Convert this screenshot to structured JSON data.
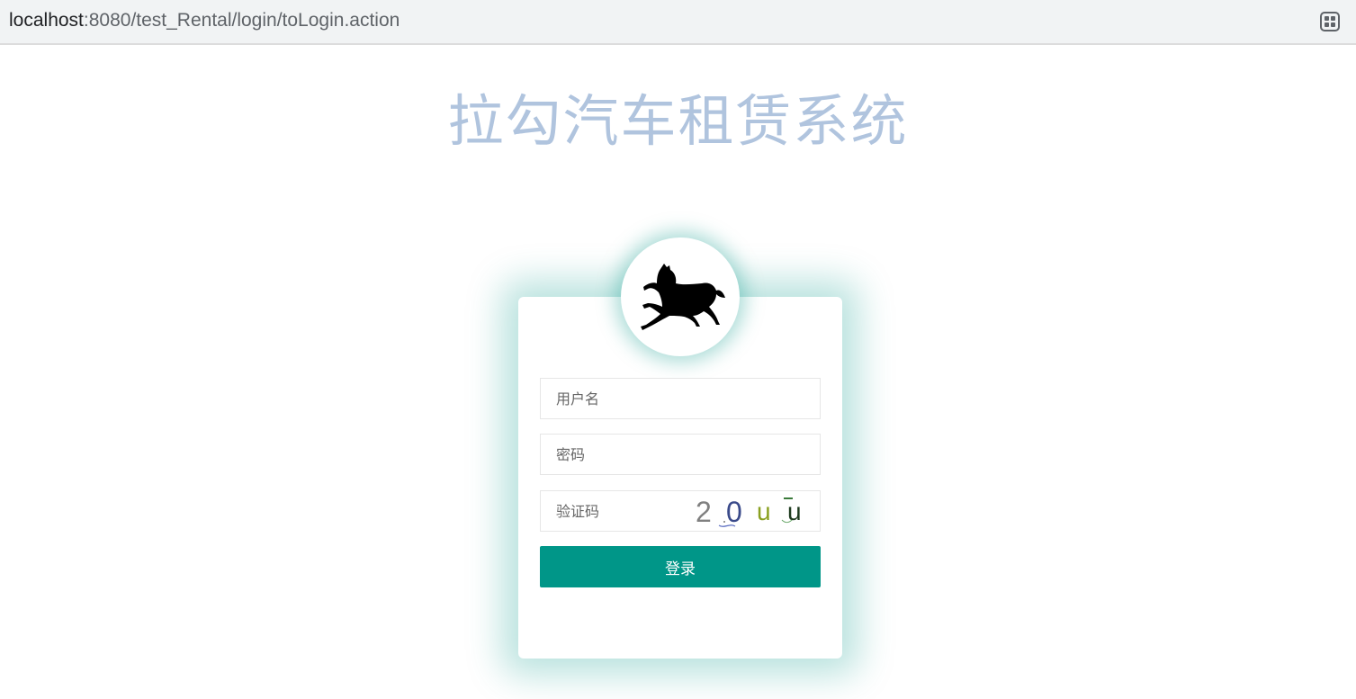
{
  "browser": {
    "url_host": "localhost",
    "url_rest": ":8080/test_Rental/login/toLogin.action",
    "apps_icon": "grid-icon"
  },
  "page": {
    "title": "拉勾汽车租赁系统",
    "logo_icon": "horse-icon"
  },
  "form": {
    "username_placeholder": "用户名",
    "password_placeholder": "密码",
    "captcha_placeholder": "验证码",
    "captcha_chars": [
      "2",
      "0",
      "u",
      "u"
    ],
    "login_label": "登录"
  },
  "colors": {
    "title": "#b0c4de",
    "accent": "#009688"
  }
}
